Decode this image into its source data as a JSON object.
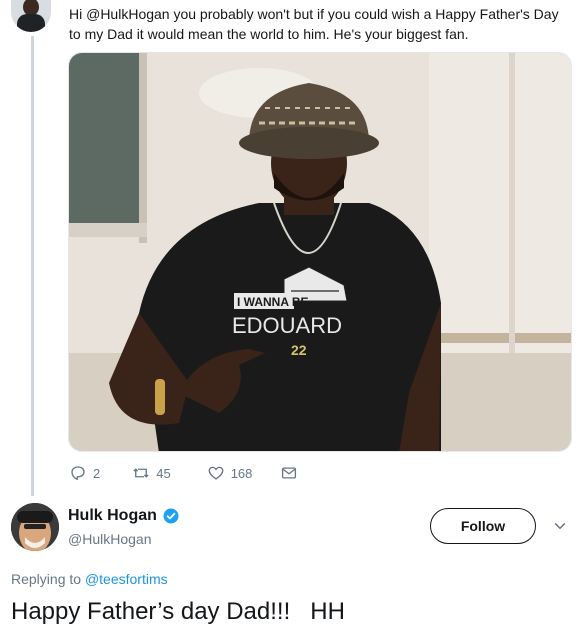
{
  "original_tweet": {
    "text": "Hi @HulkHogan you probably won't but if you could wish a Happy Father's Day to my Dad it would mean the world to him. He's your biggest fan.",
    "media": {
      "shirt_line1": "I WANNA BE",
      "shirt_line2": "EDOUARD",
      "shirt_number": "22"
    },
    "actions": {
      "replies": "2",
      "retweets": "45",
      "likes": "168"
    }
  },
  "reply_tweet": {
    "author_name": "Hulk Hogan",
    "author_handle": "@HulkHogan",
    "follow_label": "Follow",
    "replying_prefix": "Replying to",
    "replying_handle": "@teesfortims",
    "text": "Happy Father’s day Dad!!!   HH"
  },
  "colors": {
    "text": "#14171a",
    "secondary": "#657786",
    "link": "#1b95e0",
    "verified": "#1da1f2",
    "thread_line": "#ccd6dd"
  },
  "icons": [
    "reply-icon",
    "retweet-icon",
    "like-icon",
    "message-icon",
    "verified-icon",
    "chevron-down-icon"
  ]
}
